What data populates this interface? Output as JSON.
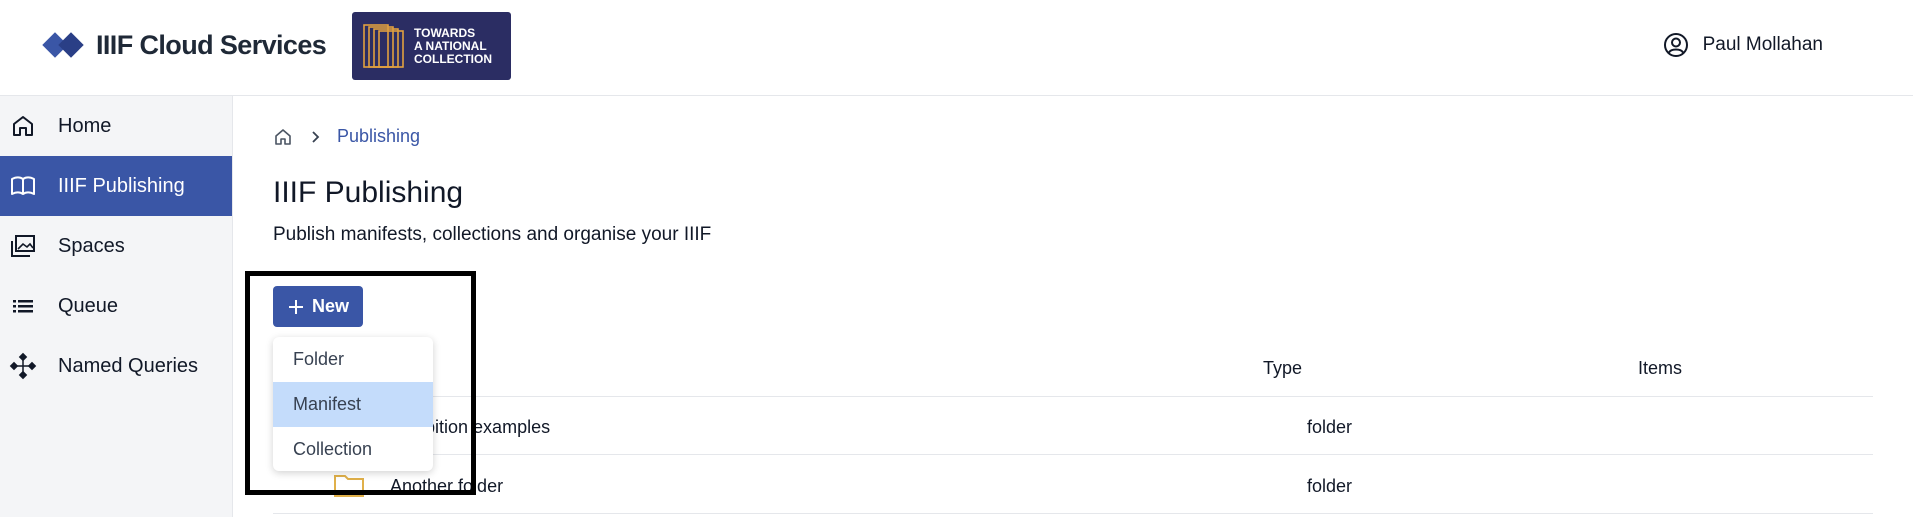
{
  "header": {
    "brand_name": "IIIF Cloud Services",
    "partner_logo": {
      "line1": "TOWARDS",
      "line2": "A NATIONAL",
      "line3": "COLLECTION"
    },
    "user_name": "Paul Mollahan"
  },
  "sidebar": {
    "items": [
      {
        "label": "Home",
        "icon": "home-icon"
      },
      {
        "label": "IIIF Publishing",
        "icon": "book-open-icon",
        "active": true
      },
      {
        "label": "Spaces",
        "icon": "images-stack-icon"
      },
      {
        "label": "Queue",
        "icon": "list-icon"
      },
      {
        "label": "Named Queries",
        "icon": "diamond-nodes-icon"
      }
    ]
  },
  "breadcrumb": {
    "current": "Publishing"
  },
  "page": {
    "title": "IIIF Publishing",
    "subtitle": "Publish manifests, collections and organise your IIIF"
  },
  "new_button": {
    "label": "New"
  },
  "new_menu": {
    "items": [
      {
        "label": "Folder"
      },
      {
        "label": "Manifest",
        "highlighted": true
      },
      {
        "label": "Collection"
      }
    ]
  },
  "table": {
    "headers": {
      "type": "Type",
      "items": "Items"
    },
    "rows": [
      {
        "name": "Exhibition examples",
        "type": "folder"
      },
      {
        "name": "Another folder",
        "type": "folder"
      }
    ]
  },
  "colors": {
    "accent": "#3a56a6",
    "menu_highlight": "#c4dcfb",
    "partner_bg": "#2b2d63"
  }
}
